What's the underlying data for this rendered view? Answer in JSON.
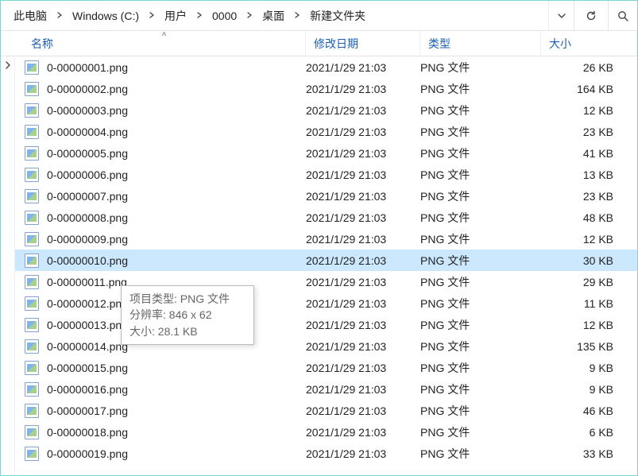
{
  "breadcrumbs": [
    "此电脑",
    "Windows (C:)",
    "用户",
    "0000",
    "桌面",
    "新建文件夹"
  ],
  "headers": {
    "name": "名称",
    "date": "修改日期",
    "type": "类型",
    "size": "大小"
  },
  "tooltip": {
    "line1": "项目类型: PNG 文件",
    "line2": "分辨率: 846 x 62",
    "line3": "大小: 28.1 KB"
  },
  "selected_index": 9,
  "files": [
    {
      "name": "0-00000001.png",
      "date": "2021/1/29 21:03",
      "type": "PNG 文件",
      "size": "26 KB"
    },
    {
      "name": "0-00000002.png",
      "date": "2021/1/29 21:03",
      "type": "PNG 文件",
      "size": "164 KB"
    },
    {
      "name": "0-00000003.png",
      "date": "2021/1/29 21:03",
      "type": "PNG 文件",
      "size": "12 KB"
    },
    {
      "name": "0-00000004.png",
      "date": "2021/1/29 21:03",
      "type": "PNG 文件",
      "size": "23 KB"
    },
    {
      "name": "0-00000005.png",
      "date": "2021/1/29 21:03",
      "type": "PNG 文件",
      "size": "41 KB"
    },
    {
      "name": "0-00000006.png",
      "date": "2021/1/29 21:03",
      "type": "PNG 文件",
      "size": "13 KB"
    },
    {
      "name": "0-00000007.png",
      "date": "2021/1/29 21:03",
      "type": "PNG 文件",
      "size": "23 KB"
    },
    {
      "name": "0-00000008.png",
      "date": "2021/1/29 21:03",
      "type": "PNG 文件",
      "size": "48 KB"
    },
    {
      "name": "0-00000009.png",
      "date": "2021/1/29 21:03",
      "type": "PNG 文件",
      "size": "12 KB"
    },
    {
      "name": "0-00000010.png",
      "date": "2021/1/29 21:03",
      "type": "PNG 文件",
      "size": "30 KB"
    },
    {
      "name": "0-00000011.png",
      "date": "2021/1/29 21:03",
      "type": "PNG 文件",
      "size": "29 KB"
    },
    {
      "name": "0-00000012.png",
      "date": "2021/1/29 21:03",
      "type": "PNG 文件",
      "size": "11 KB"
    },
    {
      "name": "0-00000013.png",
      "date": "2021/1/29 21:03",
      "type": "PNG 文件",
      "size": "12 KB"
    },
    {
      "name": "0-00000014.png",
      "date": "2021/1/29 21:03",
      "type": "PNG 文件",
      "size": "135 KB"
    },
    {
      "name": "0-00000015.png",
      "date": "2021/1/29 21:03",
      "type": "PNG 文件",
      "size": "9 KB"
    },
    {
      "name": "0-00000016.png",
      "date": "2021/1/29 21:03",
      "type": "PNG 文件",
      "size": "9 KB"
    },
    {
      "name": "0-00000017.png",
      "date": "2021/1/29 21:03",
      "type": "PNG 文件",
      "size": "46 KB"
    },
    {
      "name": "0-00000018.png",
      "date": "2021/1/29 21:03",
      "type": "PNG 文件",
      "size": "6 KB"
    },
    {
      "name": "0-00000019.png",
      "date": "2021/1/29 21:03",
      "type": "PNG 文件",
      "size": "33 KB"
    }
  ]
}
